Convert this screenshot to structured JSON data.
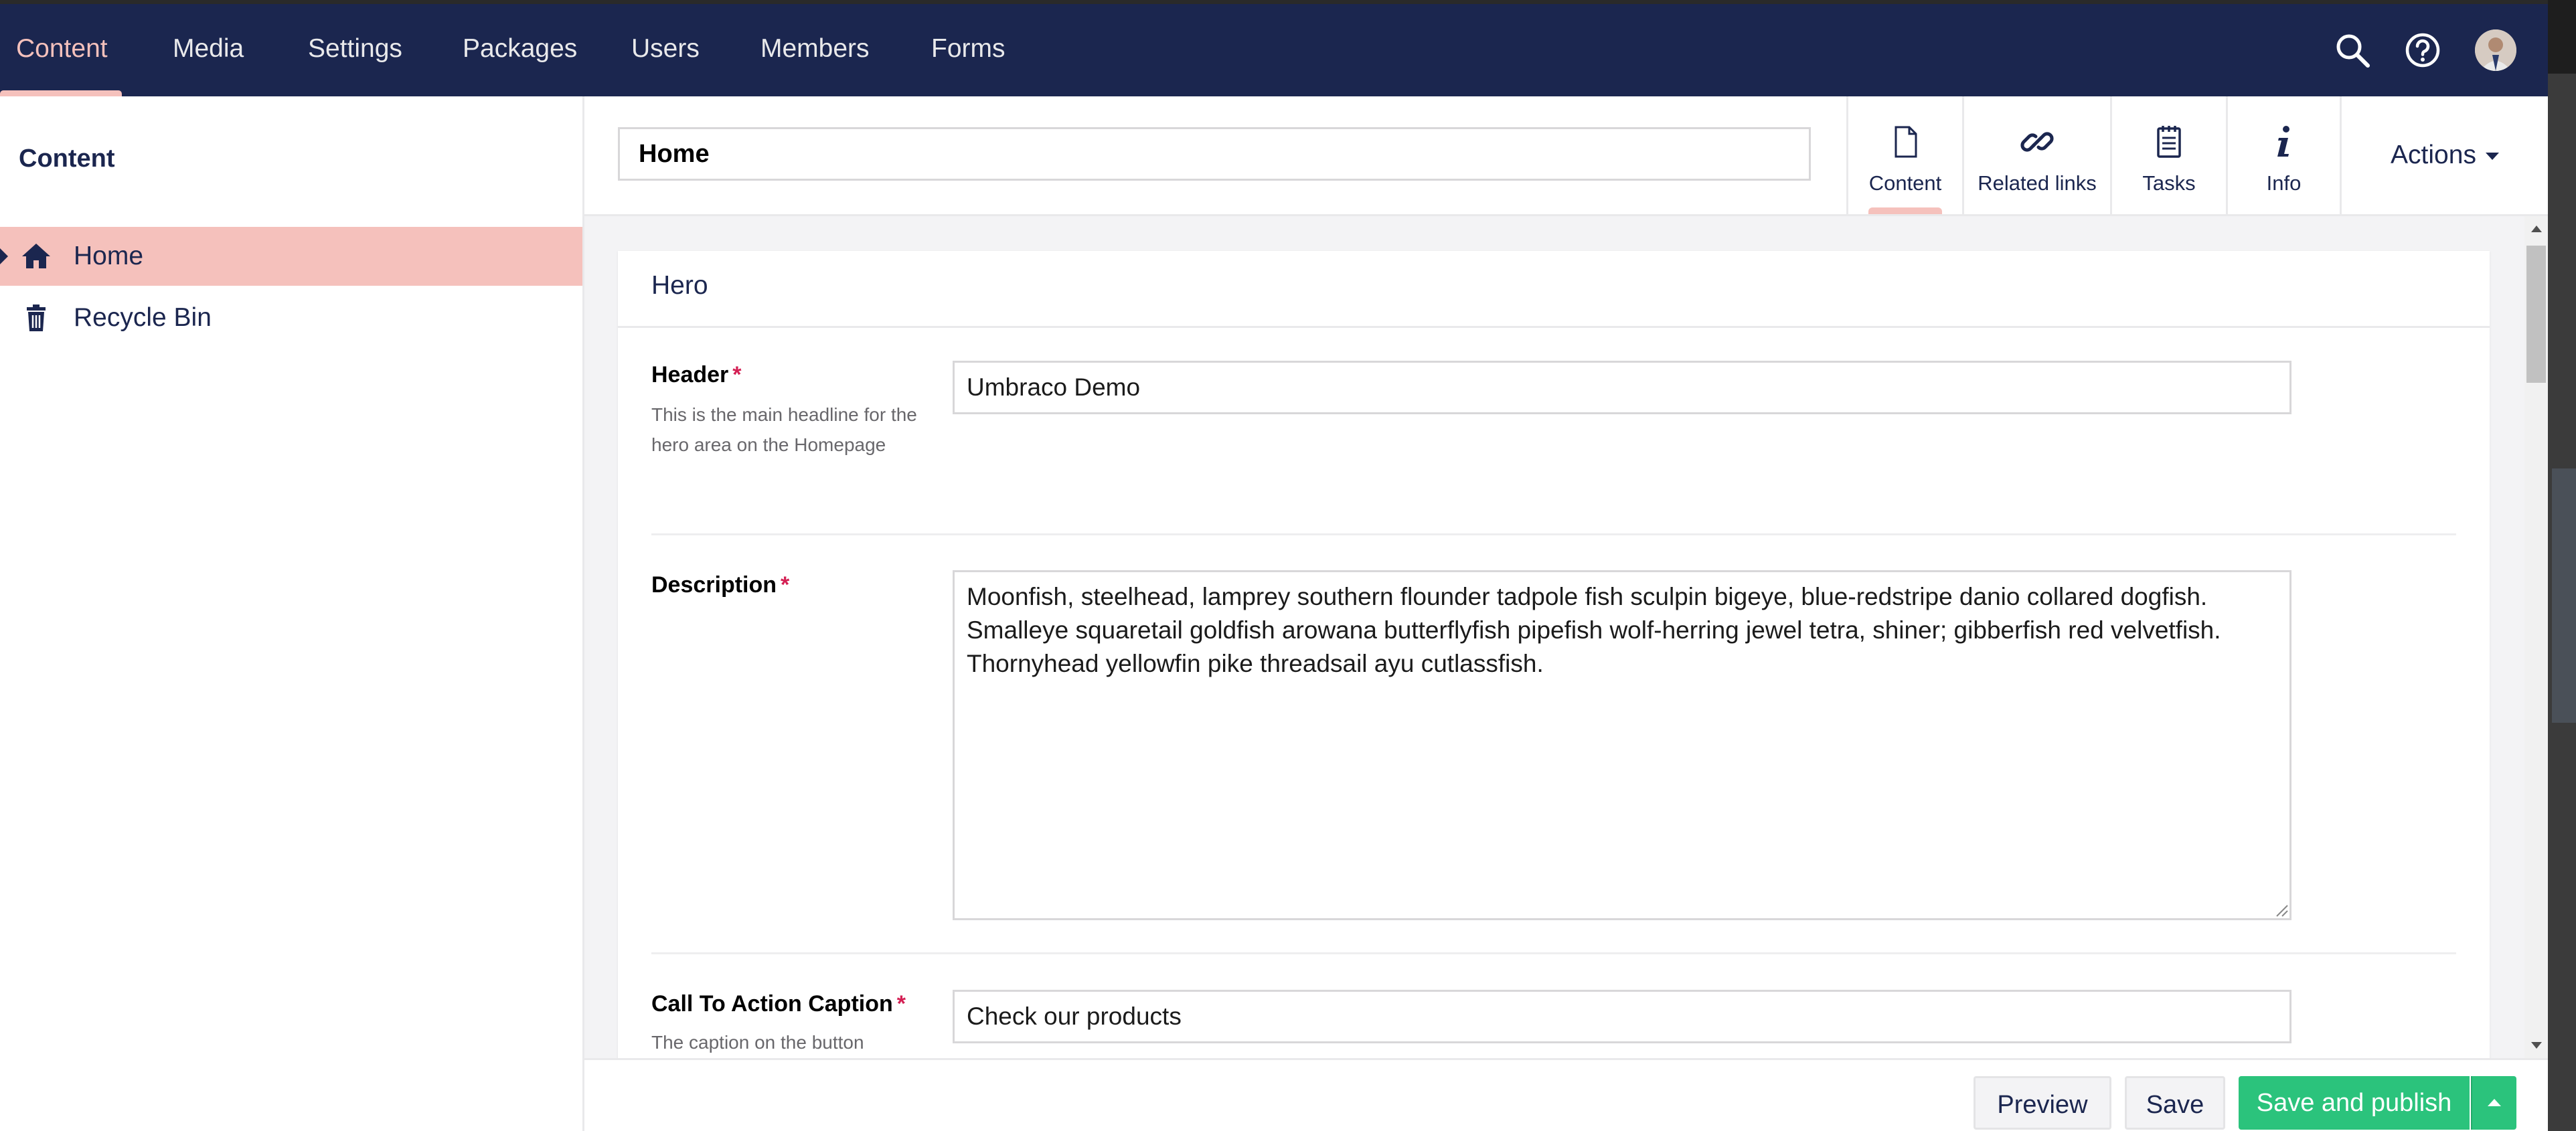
{
  "topnav": {
    "items": [
      {
        "label": "Content",
        "active": true
      },
      {
        "label": "Media"
      },
      {
        "label": "Settings"
      },
      {
        "label": "Packages"
      },
      {
        "label": "Users"
      },
      {
        "label": "Members"
      },
      {
        "label": "Forms"
      }
    ],
    "icons": [
      "search-icon",
      "help-icon",
      "user-avatar"
    ]
  },
  "sidebar": {
    "title": "Content",
    "tree": [
      {
        "label": "Home",
        "icon": "home-icon",
        "selected": true
      },
      {
        "label": "Recycle Bin",
        "icon": "trash-icon"
      }
    ]
  },
  "editor": {
    "node_name": "Home",
    "tabs": [
      {
        "label": "Content",
        "icon": "document-icon",
        "active": true
      },
      {
        "label": "Related links",
        "icon": "link-icon"
      },
      {
        "label": "Tasks",
        "icon": "notepad-icon"
      },
      {
        "label": "Info",
        "icon": "info-icon"
      }
    ],
    "actions_label": "Actions"
  },
  "panel": {
    "title": "Hero",
    "properties": [
      {
        "label": "Header",
        "required_mark": "*",
        "description": "This is the main headline for the hero area on the Homepage",
        "value": "Umbraco Demo"
      },
      {
        "label": "Description",
        "required_mark": "*",
        "value": "Moonfish, steelhead, lamprey southern flounder tadpole fish sculpin bigeye, blue-redstripe danio collared dogfish. Smalleye squaretail goldfish arowana butterflyfish pipefish wolf-herring jewel tetra, shiner; gibberfish red velvetfish. Thornyhead yellowfin pike threadsail ayu cutlassfish."
      },
      {
        "label": "Call To Action Caption",
        "required_mark": "*",
        "description": "The caption on the button",
        "value": "Check our products"
      }
    ]
  },
  "footer": {
    "preview_label": "Preview",
    "save_label": "Save",
    "save_publish_label": "Save and publish"
  },
  "colors": {
    "nav_bg": "#1b264f",
    "accent_pink": "#f5c1bc",
    "publish_green": "#2bc37c",
    "required_red": "#d42054"
  }
}
